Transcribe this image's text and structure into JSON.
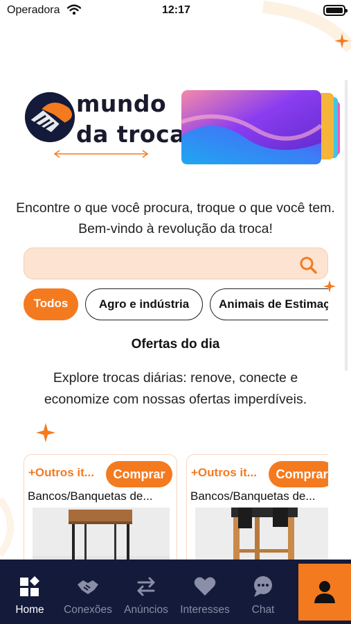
{
  "status_bar": {
    "carrier": "Operadora",
    "time": "12:17",
    "wifi_icon": "wifi-icon",
    "battery_icon": "battery-icon"
  },
  "brand": {
    "line1": "mundo",
    "line2": "da troca",
    "accent": "#f47a1f",
    "navy": "#131a3a"
  },
  "tagline": "Encontre o que você procura, troque o que você tem. Bem-vindo à revolução da troca!",
  "search": {
    "value": "",
    "placeholder": "",
    "icon": "search-icon"
  },
  "categories": [
    {
      "label": "Todos",
      "active": true
    },
    {
      "label": "Agro e indústria",
      "active": false
    },
    {
      "label": "Animais de Estimação",
      "active": false
    }
  ],
  "offers": {
    "title": "Ofertas do dia",
    "subtitle": "Explore trocas diárias: renove, conecte e economize com nossas ofertas imperdíveis."
  },
  "products": [
    {
      "category": "+Outros it...",
      "buy_label": "Comprar",
      "title": "Bancos/Banquetas de..."
    },
    {
      "category": "+Outros it...",
      "buy_label": "Comprar",
      "title": "Bancos/Banquetas de..."
    }
  ],
  "tabbar": [
    {
      "label": "Home",
      "icon": "home-icon",
      "active": true
    },
    {
      "label": "Conexões",
      "icon": "handshake-icon",
      "active": false
    },
    {
      "label": "Anúncios",
      "icon": "swap-icon",
      "active": false
    },
    {
      "label": "Interesses",
      "icon": "heart-icon",
      "active": false
    },
    {
      "label": "Chat",
      "icon": "chat-icon",
      "active": false
    }
  ],
  "profile_tab": {
    "icon": "profile-icon"
  }
}
